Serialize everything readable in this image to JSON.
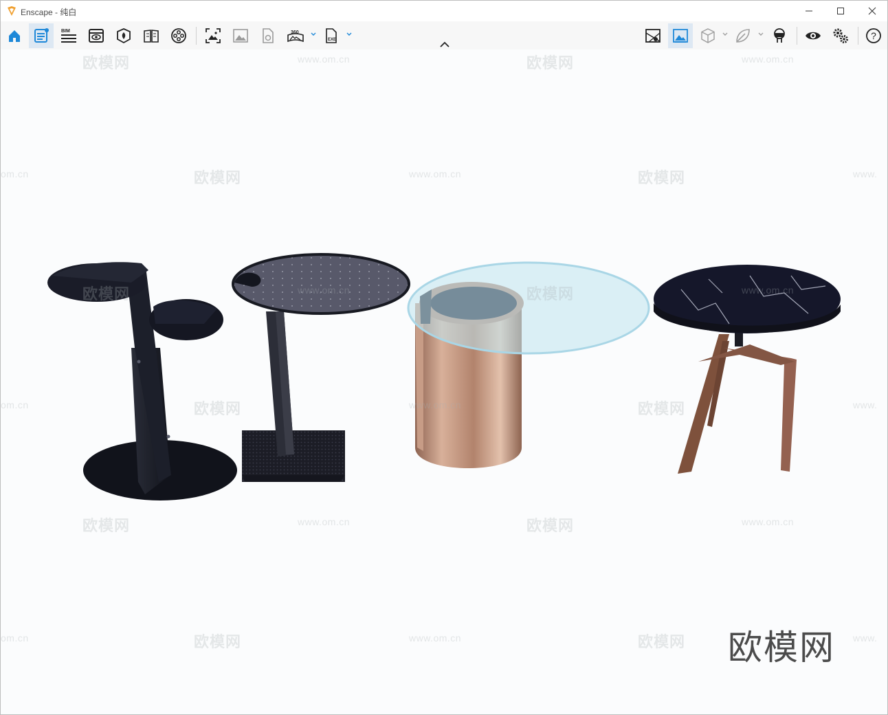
{
  "window": {
    "app_name": "Enscape",
    "title_separator": " - ",
    "document": "纯白"
  },
  "toolbar": {
    "left_tools": [
      {
        "name": "home",
        "icon": "home-icon"
      },
      {
        "name": "capture-view",
        "icon": "notes-icon",
        "active": true
      },
      {
        "name": "bim",
        "icon": "bim-icon",
        "label": "BIM"
      },
      {
        "name": "view-manager",
        "icon": "view-eye-icon"
      },
      {
        "name": "section-cube",
        "icon": "cube-tag-icon"
      },
      {
        "name": "material-book",
        "icon": "book-icon"
      },
      {
        "name": "video",
        "icon": "film-reel-icon"
      },
      {
        "name": "screenshot",
        "icon": "screenshot-icon"
      },
      {
        "name": "batch-render",
        "icon": "image-icon"
      },
      {
        "name": "export-file",
        "icon": "file-export-icon"
      },
      {
        "name": "panorama",
        "icon": "panorama-icon",
        "label": "360"
      },
      {
        "name": "standalone",
        "icon": "exe-file-icon",
        "label": "EXE"
      }
    ],
    "right_tools": [
      {
        "name": "map",
        "icon": "map-icon"
      },
      {
        "name": "atmosphere",
        "icon": "landscape-icon",
        "active": true
      },
      {
        "name": "asset-cube",
        "icon": "cube-icon"
      },
      {
        "name": "leaf-library",
        "icon": "leaf-icon"
      },
      {
        "name": "vr-headset",
        "icon": "vr-icon"
      },
      {
        "name": "visual-settings",
        "icon": "eye-icon"
      },
      {
        "name": "settings",
        "icon": "gears-icon"
      },
      {
        "name": "help",
        "icon": "help-icon",
        "label": "?"
      }
    ]
  },
  "watermarks": {
    "brand_cn": "欧模网",
    "site_url": "www.om.cn",
    "site_url_partial": "om.cn",
    "site_url_prefix": "www.",
    "corner_brand": "欧模网"
  },
  "scene": {
    "objects": [
      "dark-metal-s-shaped-side-table",
      "round-perforated-top-pedestal-table",
      "glass-top-copper-cylinder-table",
      "black-marble-top-tripod-table"
    ],
    "colors": {
      "dark_metal": "#1d2230",
      "copper": "#b98a72",
      "glass": "#bfe3ef",
      "marble": "#14172a",
      "wood_leg": "#8a5a44"
    }
  }
}
